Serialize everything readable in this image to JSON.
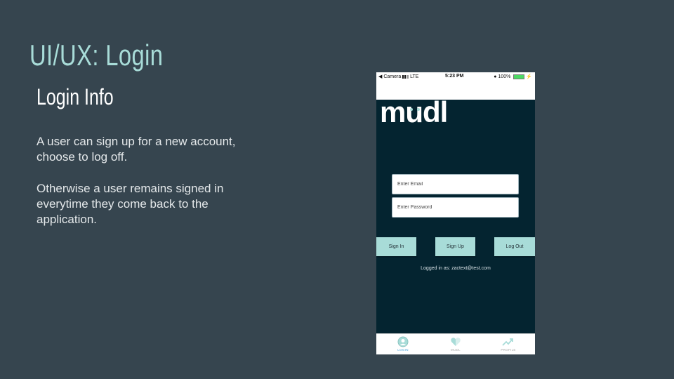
{
  "slide": {
    "title": "UI/UX: Login",
    "subtitle": "Login Info",
    "paragraphs": [
      "A user can sign up for a new account, choose to log off.",
      "Otherwise a user remains signed in everytime they come back to the application."
    ]
  },
  "phone": {
    "status_bar": {
      "carrier": "Camera",
      "network": "LTE",
      "time": "5:23 PM",
      "battery": "100%"
    },
    "app": {
      "logo": "mudl",
      "email_placeholder": "Enter Email",
      "password_placeholder": "Enter Password",
      "buttons": {
        "sign_in": "Sign In",
        "sign_up": "Sign Up",
        "log_out": "Log Out"
      },
      "logged_in_text": "Logged in as: zactext@test.com"
    },
    "tabs": [
      {
        "label": "LOGIN",
        "icon": "user-icon",
        "active": true
      },
      {
        "label": "MUDL",
        "icon": "heart-icon",
        "active": false
      },
      {
        "label": "PROFILE",
        "icon": "trend-up-icon",
        "active": false
      }
    ]
  },
  "colors": {
    "slide_background": "#36454f",
    "title_accent": "#a8dcd8",
    "app_background": "#042430",
    "button": "#a8dcd8",
    "active_tab": "#4aa3d8"
  }
}
